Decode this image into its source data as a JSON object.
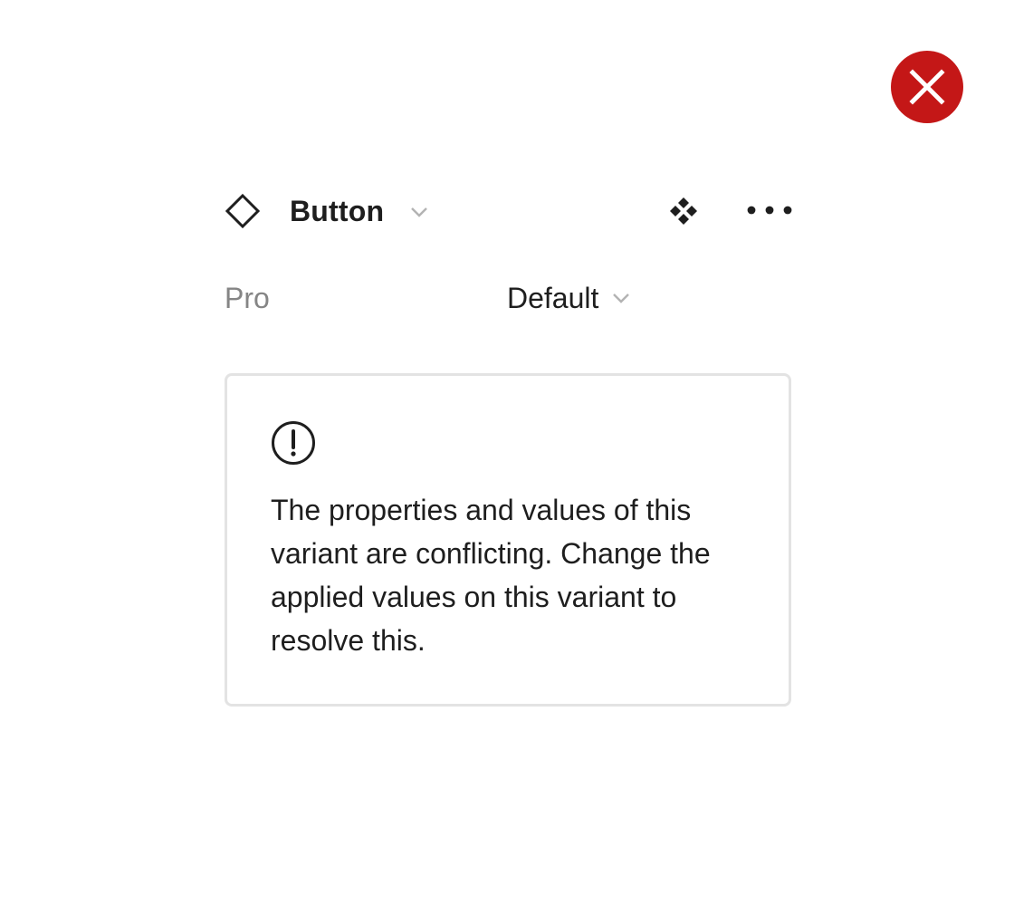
{
  "close_badge": {
    "icon": "close-icon",
    "color": "#c41717"
  },
  "header": {
    "component_icon": "component-diamond-icon",
    "title": "Button",
    "title_chevron_icon": "chevron-down-icon",
    "variant_icon": "variant-icon",
    "more_icon": "more-horizontal-icon"
  },
  "property": {
    "label": "Pro",
    "value": "Default",
    "chevron_icon": "chevron-down-icon"
  },
  "warning": {
    "icon": "alert-circle-icon",
    "message": "The properties and values of this variant are conflicting. Change the applied values on this variant to resolve this."
  }
}
